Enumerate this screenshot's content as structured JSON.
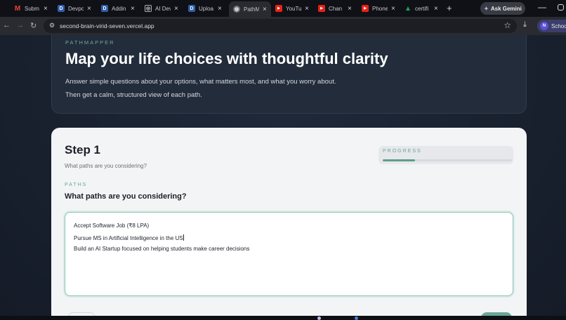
{
  "browser": {
    "tabs": [
      {
        "title": "Subm",
        "icon": "gmail-icon",
        "color": "#ea4335",
        "glyph": "M"
      },
      {
        "title": "Devpo",
        "icon": "d-icon",
        "color": "#2f5ea8",
        "glyph": "D"
      },
      {
        "title": "Addin",
        "icon": "d-icon",
        "color": "#2f5ea8",
        "glyph": "D"
      },
      {
        "title": "AI Dev",
        "icon": "ai-icon",
        "color": "#7a7f88",
        "glyph": "◎"
      },
      {
        "title": "Uploa",
        "icon": "d-icon",
        "color": "#2f5ea8",
        "glyph": "D"
      },
      {
        "title": "PathM",
        "icon": "globe-icon",
        "color": "#8a8f98",
        "glyph": "◍",
        "active": true
      },
      {
        "title": "YouTu",
        "icon": "youtube-icon",
        "color": "#e62117",
        "glyph": "▶"
      },
      {
        "title": "Chan",
        "icon": "youtube-icon",
        "color": "#e62117",
        "glyph": "▶"
      },
      {
        "title": "Phone",
        "icon": "youtube-icon",
        "color": "#e62117",
        "glyph": "▶"
      },
      {
        "title": "certifi",
        "icon": "drive-icon",
        "color": "#1fa463",
        "glyph": "▲"
      }
    ],
    "ask_gemini": "Ask Gemini",
    "url": "second-brain-virid-seven.vercel.app",
    "profile_label": "School",
    "profile_initial": "N"
  },
  "hero": {
    "eyebrow": "PATHMAPPER",
    "title": "Map your life choices with thoughtful clarity",
    "subtitle_1": "Answer simple questions about your options, what matters most, and what you worry about.",
    "subtitle_2": "Then get a calm, structured view of each path."
  },
  "step": {
    "title": "Step 1",
    "subtitle": "What paths are you considering?",
    "progress_label": "PROGRESS",
    "progress_fraction": 0.25
  },
  "field": {
    "eyebrow": "PATHS",
    "title": "What paths are you considering?",
    "lines": [
      "Accept Software Job (₹8 LPA)",
      "Pursue MS in Artificial Intelligence in the US",
      "Build an AI Startup focused on helping students make career decisions"
    ]
  },
  "colors": {
    "accent": "#6aa697",
    "card_bg": "#f3f4f6",
    "page_bg": "#1c2433"
  }
}
